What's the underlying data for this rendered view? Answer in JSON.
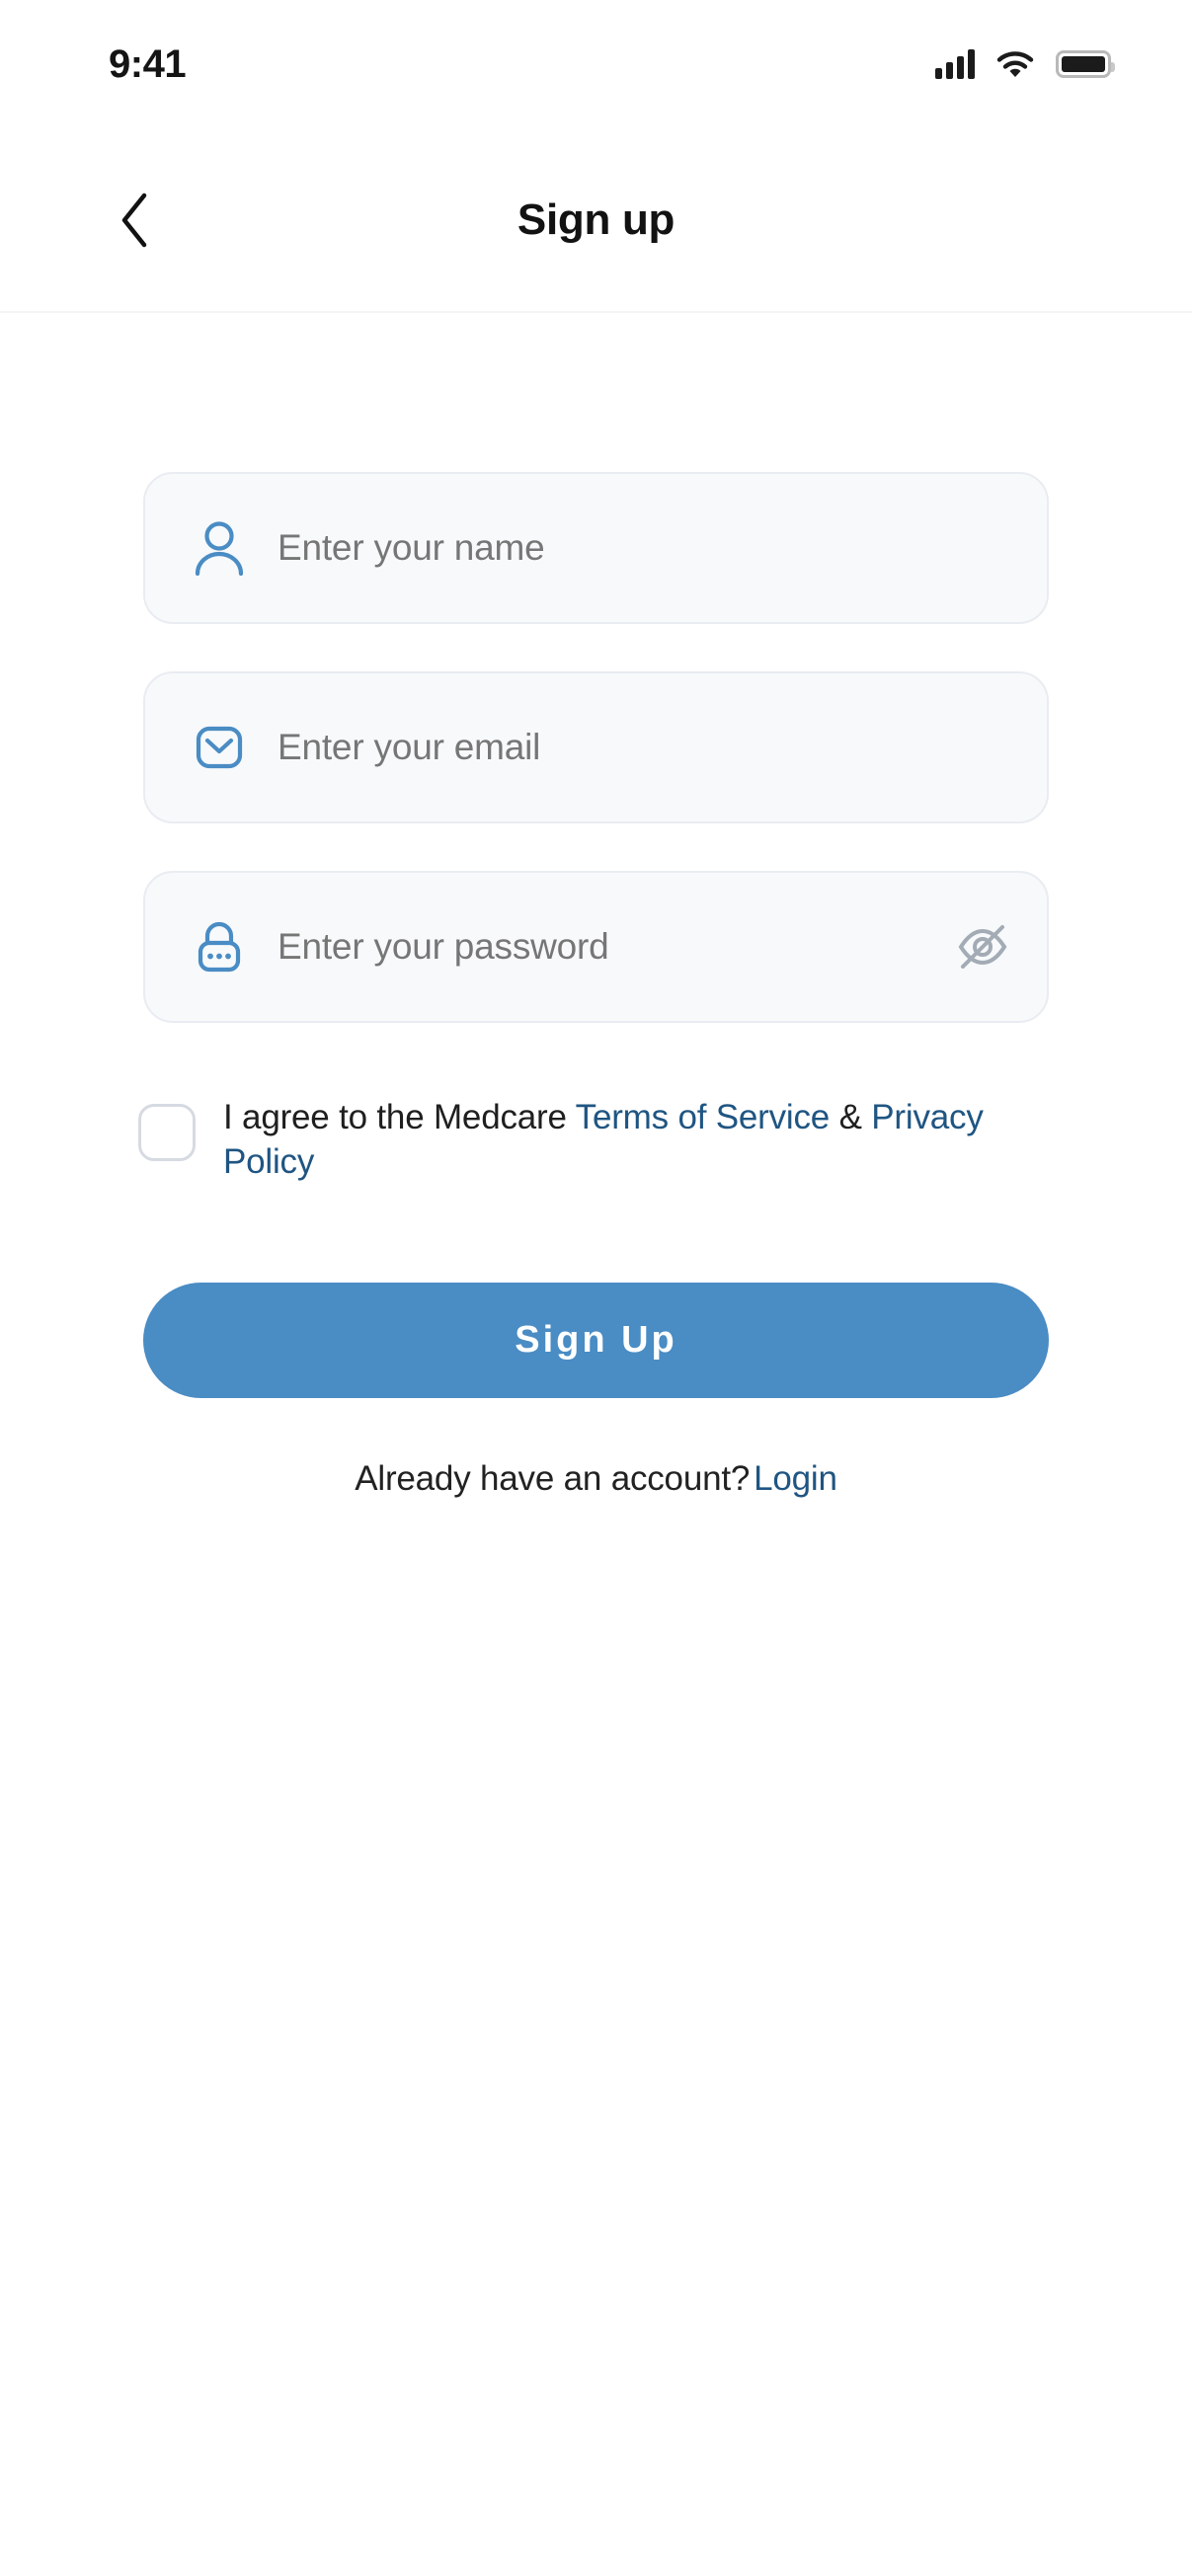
{
  "status_bar": {
    "time": "9:41",
    "signal_icon": "cellular-signal-icon",
    "wifi_icon": "wifi-icon",
    "battery_icon": "battery-full-icon",
    "signal_bars_filled": 4,
    "signal_bars_total": 4,
    "battery_level_percent": 100
  },
  "header": {
    "back_icon": "chevron-left-icon",
    "title": "Sign up"
  },
  "form": {
    "name_field": {
      "icon": "user-icon",
      "placeholder": "Enter your name",
      "value": ""
    },
    "email_field": {
      "icon": "envelope-icon",
      "placeholder": "Enter your email",
      "value": ""
    },
    "password_field": {
      "icon": "lock-icon",
      "placeholder": "Enter your password",
      "value": "",
      "toggle_icon": "eye-off-icon",
      "masked": true
    }
  },
  "agreement": {
    "checked": false,
    "text_before": "I agree to the Medcare ",
    "terms_link": "Terms of Service",
    "separator": " & ",
    "privacy_link": "Privacy Policy"
  },
  "actions": {
    "signup_label": "Sign Up"
  },
  "login_prompt": {
    "text": "Already have an account?",
    "link": "Login"
  },
  "colors": {
    "brand_blue": "#4a8cc4",
    "link_navy": "#1f5582",
    "field_bg": "#f7f9fb",
    "field_border": "#e9ecf1",
    "checkbox_border": "#d6dae1",
    "placeholder_text": "#767676",
    "eye_off_gray": "#a3abb5"
  }
}
